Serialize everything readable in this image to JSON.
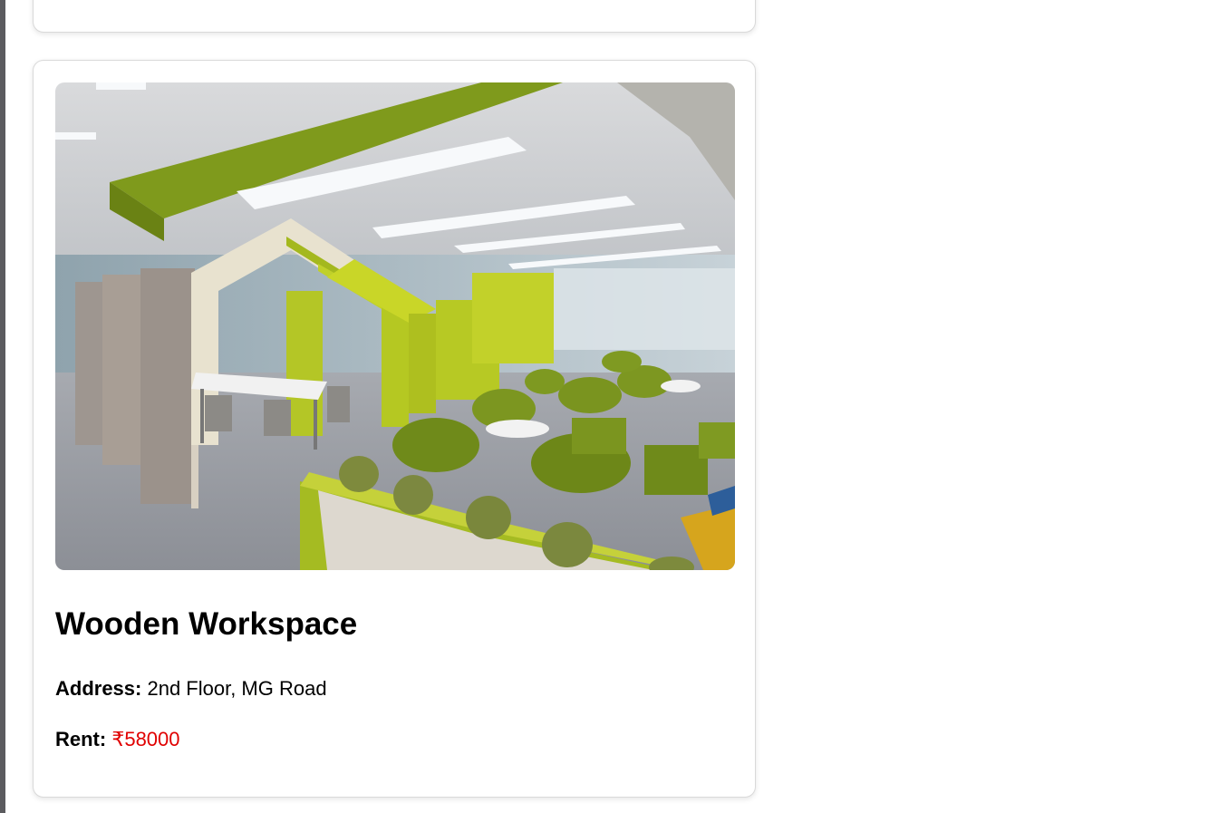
{
  "listing": {
    "title": "Wooden Workspace",
    "address_label": "Address:",
    "address_value": "2nd Floor, MG Road",
    "rent_label": "Rent:",
    "rent_value": "₹58000"
  },
  "colors": {
    "rent_accent": "#e00000",
    "card_border": "#d9d9d9",
    "sidebar_edge": "#5b5b5f"
  }
}
